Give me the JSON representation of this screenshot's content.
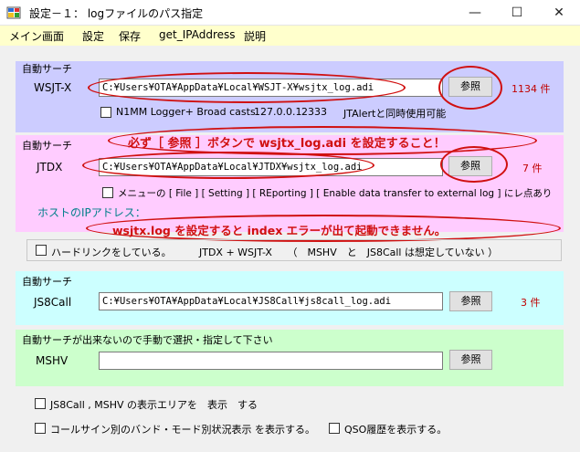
{
  "window": {
    "title": "設定－１：  logファイルのパス指定",
    "minimize": "—",
    "maximize": "☐",
    "close": "✕"
  },
  "menu": [
    "メイン画面",
    "設定",
    "保存",
    "get_IPAddress",
    "説明"
  ],
  "wsjtx": {
    "group_label": "自動サーチ",
    "label": "WSJT-X",
    "path": "C:¥Users¥OTA¥AppData¥Local¥WSJT-X¥wsjtx_log.adi",
    "browse": "参照",
    "count": "1134 件",
    "n1mm_checkbox": "N1MM Logger+ Broad casts",
    "ip": "127.0.0.1",
    "port": "2333",
    "jtalert_note": "JTAlertと同時使用可能"
  },
  "notice1": "必ず［ 参照 ］ボタンで wsjtx_log.adi を設定すること！",
  "jtdx": {
    "group_label": "自動サーチ",
    "label": "JTDX",
    "path": "C:¥Users¥OTA¥AppData¥Local¥JTDX¥wsjtx_log.adi",
    "browse": "参照",
    "count": "7 件",
    "menu_checkbox": "メニューの [ File ] [ Setting ] [ REporting ] [ Enable data transfer to external log ] にレ点あり",
    "host_label": "ホストのIPアドレス："
  },
  "notice2": "wsjtx.log を設定すると index エラーが出て起動できません。",
  "hardlink": {
    "checkbox": "ハードリンクをしている。",
    "note": "JTDX + WSJT-X　　（　MSHV　と　JS8Call は想定していない ）"
  },
  "js8call": {
    "group_label": "自動サーチ",
    "label": "JS8Call",
    "path": "C:¥Users¥OTA¥AppData¥Local¥JS8Call¥js8call_log.adi",
    "browse": "参照",
    "count": "3 件"
  },
  "mshv": {
    "group_label": "自動サーチが出来ないので手動で選択・指定して下さい",
    "label": "MSHV",
    "path": "",
    "browse": "参照"
  },
  "options": {
    "show_area": "JS8Call , MSHV の表示エリアを　表示　する",
    "band_mode": "コールサイン別のバンド・モード別状況表示 を表示する。",
    "qso_history": "QSO履歴を表示する。"
  },
  "colors": {
    "wsjtx_bg": "#ccccff",
    "jtdx_bg": "#ffccff",
    "js8_bg": "#ccffff",
    "mshv_bg": "#ccffcc",
    "menubar": "#ffffcc",
    "alert": "#d01010"
  }
}
